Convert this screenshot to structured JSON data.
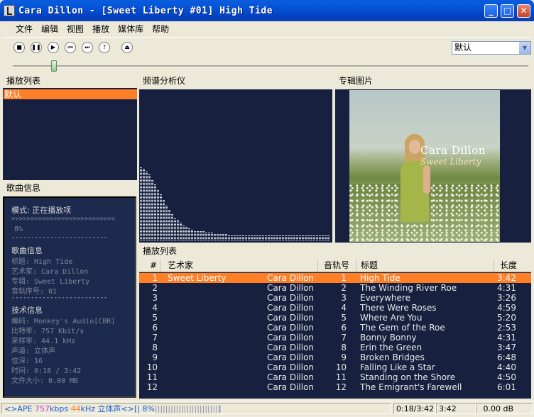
{
  "window": {
    "title": "Cara Dillon - [Sweet Liberty #01] High Tide"
  },
  "menu": [
    "文件",
    "编辑",
    "视图",
    "播放",
    "媒体库",
    "帮助"
  ],
  "toolbar": {
    "preset": "默认"
  },
  "panels": {
    "playlist_header": "播放列表",
    "spectrum_header": "频谱分析仪",
    "album_header": "专辑图片",
    "songinfo_header": "歌曲信息",
    "playlist2_header": "播放列表"
  },
  "playlists": [
    "默认"
  ],
  "album_art": {
    "artist_text": "Cara Dillon",
    "album_text": "Sweet Liberty"
  },
  "songinfo": {
    "mode_line": "模式: 正在播放项",
    "progress_bar": ">>>>>>>>>>>>>>>>>>>>>>>>>>>",
    "percent": "8%",
    "sep1": "-------------------------",
    "section1": "歌曲信息",
    "title": "标题: High Tide",
    "artist": "艺术家: Cara Dillon",
    "album": "专辑: Sweet Liberty",
    "track": "音轨序号: 01",
    "sep2": "-------------------------",
    "section2": "技术信息",
    "codec": "编码: Monkey's Audio[CBR]",
    "bitrate": "比特率: 757 Kbit/s",
    "samplerate": "采样率: 44.1 kHz",
    "channels": "声道: 立体声",
    "bitdepth": "位深: 16",
    "time": "时间: 0:18 / 3:42",
    "filesize": "文件大小: 0.00 MB"
  },
  "table": {
    "headers": [
      "#",
      "艺术家",
      "音轨号",
      "标题",
      "长度"
    ],
    "rows": [
      {
        "num": "1",
        "album": "Sweet Liberty",
        "artist": "Cara Dillon",
        "track": "1",
        "title": "High Tide",
        "length": "3:42"
      },
      {
        "num": "2",
        "album": "",
        "artist": "Cara Dillon",
        "track": "2",
        "title": "The Winding River Roe",
        "length": "4:31"
      },
      {
        "num": "3",
        "album": "",
        "artist": "Cara Dillon",
        "track": "3",
        "title": "Everywhere",
        "length": "3:26"
      },
      {
        "num": "4",
        "album": "",
        "artist": "Cara Dillon",
        "track": "4",
        "title": "There Were Roses",
        "length": "4:59"
      },
      {
        "num": "5",
        "album": "",
        "artist": "Cara Dillon",
        "track": "5",
        "title": "Where Are You",
        "length": "5:20"
      },
      {
        "num": "6",
        "album": "",
        "artist": "Cara Dillon",
        "track": "6",
        "title": "The Gem of the Roe",
        "length": "2:53"
      },
      {
        "num": "7",
        "album": "",
        "artist": "Cara Dillon",
        "track": "7",
        "title": "Bonny Bonny",
        "length": "4:31"
      },
      {
        "num": "8",
        "album": "",
        "artist": "Cara Dillon",
        "track": "8",
        "title": "Erin the Green",
        "length": "3:47"
      },
      {
        "num": "9",
        "album": "",
        "artist": "Cara Dillon",
        "track": "9",
        "title": "Broken Bridges",
        "length": "6:48"
      },
      {
        "num": "10",
        "album": "",
        "artist": "Cara Dillon",
        "track": "10",
        "title": "Falling Like a Star",
        "length": "4:40"
      },
      {
        "num": "11",
        "album": "",
        "artist": "Cara Dillon",
        "track": "11",
        "title": "Standing on the Shore",
        "length": "4:50"
      },
      {
        "num": "12",
        "album": "",
        "artist": "Cara Dillon",
        "track": "12",
        "title": "The Emigrant's Farewell",
        "length": "6:01"
      }
    ]
  },
  "status": {
    "left": "<>APE 757kbps 44kHz 立体声<>[| 8%|||||||||||||||||||||||]",
    "time": "0:18/3:42",
    "length": "3:42",
    "volume": "0.00 dB"
  },
  "spectrum_levels": [
    0.58,
    0.56,
    0.54,
    0.52,
    0.48,
    0.44,
    0.4,
    0.36,
    0.32,
    0.28,
    0.24,
    0.21,
    0.18,
    0.16,
    0.14,
    0.12,
    0.11,
    0.1,
    0.09,
    0.08,
    0.08,
    0.07,
    0.07,
    0.06,
    0.06,
    0.06,
    0.05,
    0.05,
    0.05,
    0.05,
    0.05,
    0.04,
    0.04,
    0.04,
    0.04,
    0.04,
    0.04,
    0.04,
    0.04,
    0.04,
    0.04,
    0.04,
    0.04,
    0.04,
    0.04,
    0.04,
    0.04,
    0.04,
    0.04,
    0.04,
    0.04,
    0.04,
    0.04,
    0.04,
    0.04,
    0.04,
    0.04,
    0.04,
    0.04,
    0.04,
    0.04,
    0.04,
    0.04,
    0.04,
    0.04,
    0.04,
    0.04
  ],
  "seek_position": 0.08
}
